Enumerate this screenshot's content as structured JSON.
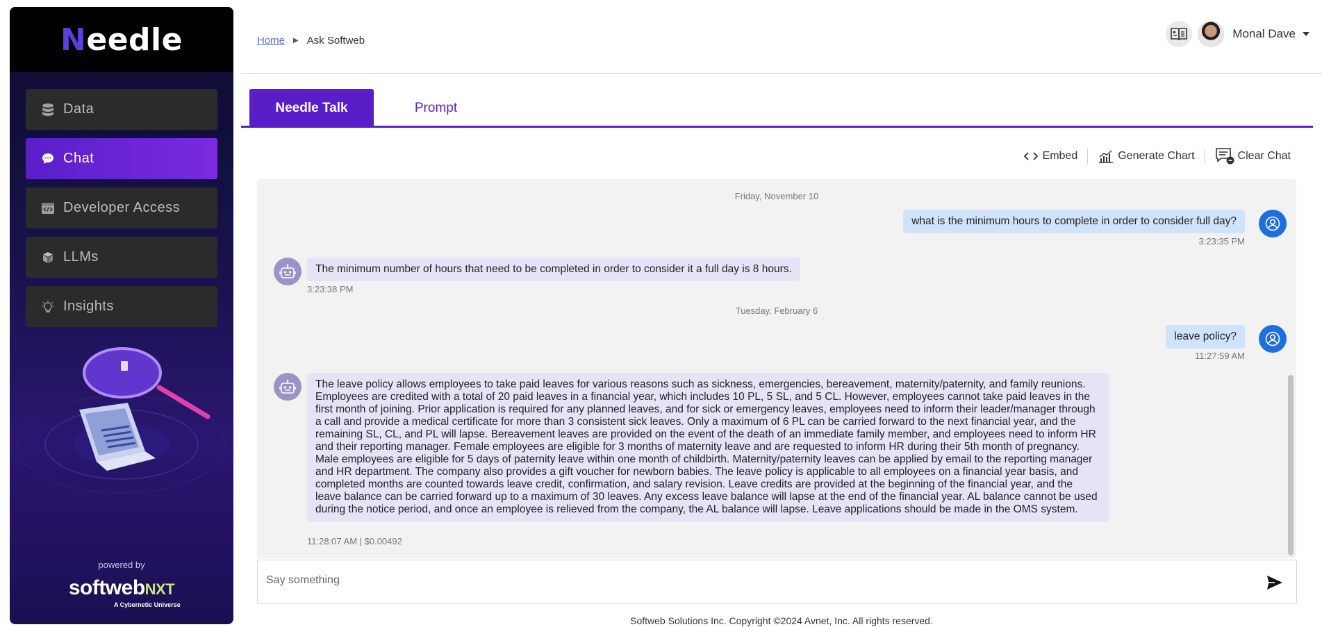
{
  "sidebar": {
    "logo": {
      "first": "N",
      "rest": "eedle"
    },
    "items": [
      {
        "label": "Data",
        "icon": "database-icon"
      },
      {
        "label": "Chat",
        "icon": "chat-bubble-icon"
      },
      {
        "label": "Developer Access",
        "icon": "code-window-icon"
      },
      {
        "label": "LLMs",
        "icon": "cube-icon"
      },
      {
        "label": "Insights",
        "icon": "lightbulb-icon"
      }
    ],
    "active_index": 1,
    "powered_by": "powered by",
    "brand": {
      "name": "softweb",
      "suffix": "NXT",
      "tagline": "A Cybernetic Universe"
    }
  },
  "header": {
    "breadcrumb": {
      "home": "Home",
      "current": "Ask Softweb"
    },
    "user": {
      "name": "Monal Dave",
      "guide_icon": "book-guide-icon",
      "avatar": "avatar"
    }
  },
  "tabs": [
    {
      "label": "Needle Talk",
      "active": true
    },
    {
      "label": "Prompt",
      "active": false
    }
  ],
  "toolbar": {
    "embed": "Embed",
    "generate_chart": "Generate Chart",
    "clear_chat": "Clear Chat"
  },
  "chat": {
    "date1": "Friday, November 10",
    "q1": {
      "text": "what is the minimum hours to complete in order to consider full day?",
      "time": "3:23:35 PM"
    },
    "a1": {
      "text": "The minimum number of hours that need to be completed in order to consider it a full day is 8 hours.",
      "time": "3:23:38 PM"
    },
    "date2": "Tuesday, February 6",
    "q2": {
      "text": "leave policy?",
      "time": "11:27:59 AM"
    },
    "a2": {
      "text": "The leave policy allows employees to take paid leaves for various reasons such as sickness, emergencies, bereavement, maternity/paternity, and family reunions. Employees are credited with a total of 20 paid leaves in a financial year, which includes 10 PL, 5 SL, and 5 CL. However, employees cannot take paid leaves in the first month of joining. Prior application is required for any planned leaves, and for sick or emergency leaves, employees need to inform their leader/manager through a call and provide a medical certificate for more than 3 consistent sick leaves. Only a maximum of 6 PL can be carried forward to the next financial year, and the remaining SL, CL, and PL will lapse. Bereavement leaves are provided on the event of the death of an immediate family member, and employees need to inform HR and their reporting manager. Female employees are eligible for 3 months of maternity leave and are requested to inform HR during their 5th month of pregnancy. Male employees are eligible for 5 days of paternity leave within one month of childbirth. Maternity/paternity leaves can be applied by email to the reporting manager and HR department. The company also provides a gift voucher for newborn babies. The leave policy is applicable to all employees on a financial year basis, and completed months are counted towards leave credit, confirmation, and salary revision. Leave credits are provided at the beginning of the financial year, and the leave balance can be carried forward up to a maximum of 30 leaves. Any excess leave balance will lapse at the end of the financial year. AL balance cannot be used during the notice period, and once an employee is relieved from the company, the AL balance will lapse. Leave applications should be made in the OMS system.",
      "time": "11:28:07 AM | $0.00492"
    }
  },
  "input": {
    "placeholder": "Say something",
    "value": ""
  },
  "footer": "Softweb Solutions Inc. Copyright ©2024 Avnet, Inc. All rights reserved.",
  "colors": {
    "accent": "#5a1ec9",
    "user_bubble": "#cfe3fb",
    "bot_bubble": "#e6e3f7",
    "user_avatar": "#1d6fe0"
  }
}
